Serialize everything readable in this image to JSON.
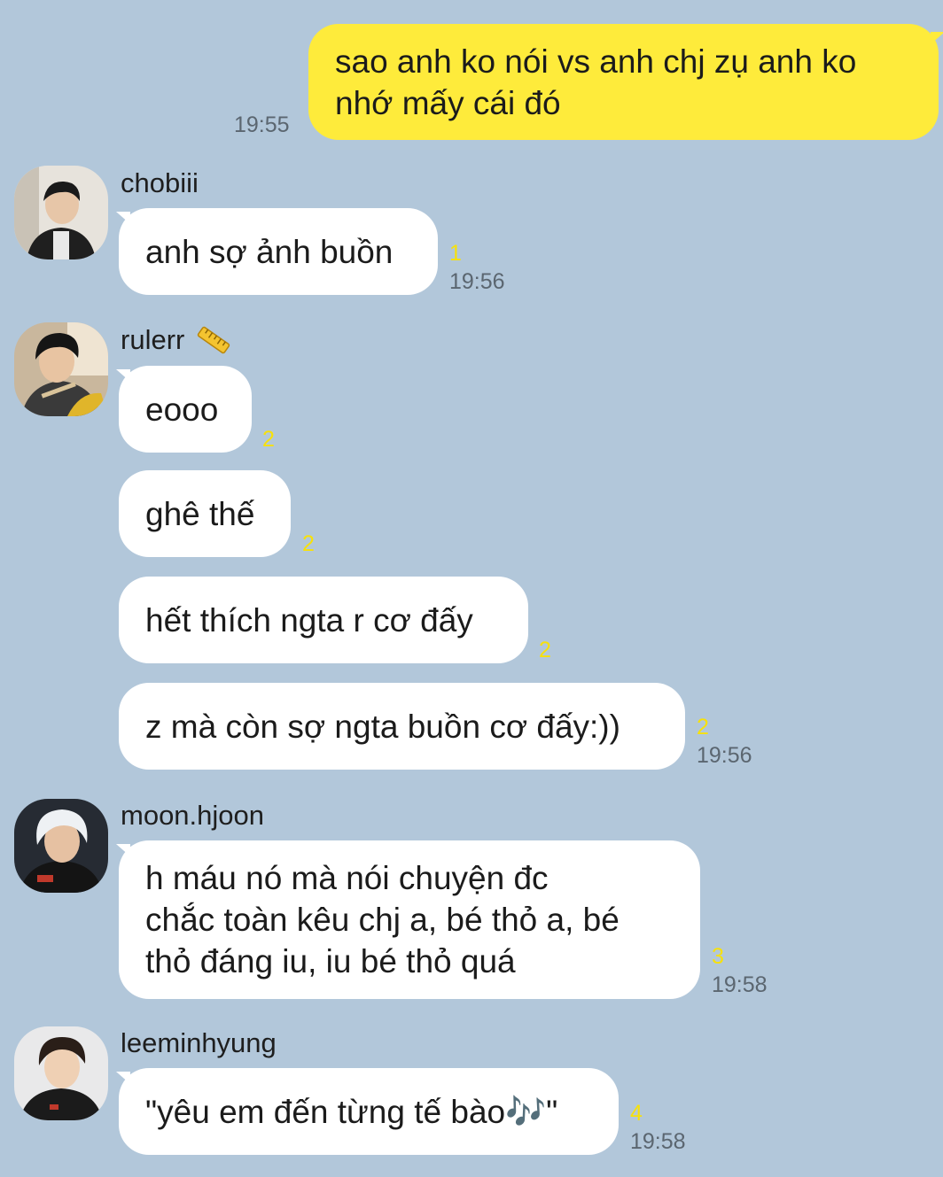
{
  "colors": {
    "background": "#b2c7da",
    "outgoing_bubble": "#feeb3b",
    "incoming_bubble": "#ffffff",
    "unread_count": "#f7e10b",
    "timestamp": "#5b6670"
  },
  "messages": {
    "m1": {
      "text": "sao anh ko nói vs anh chj zụ anh ko\nnhớ mấy cái đó",
      "time": "19:55"
    },
    "chobiii": {
      "name": "chobiii",
      "text": "anh sợ ảnh buồn",
      "unread": "1",
      "time": "19:56"
    },
    "rulerr": {
      "name": "rulerr",
      "badge_icon": "ruler-emoji-icon",
      "b1": {
        "text": "eooo",
        "unread": "2"
      },
      "b2": {
        "text": "ghê thế",
        "unread": "2"
      },
      "b3": {
        "text": "hết thích ngta r cơ đấy",
        "unread": "2"
      },
      "b4": {
        "text": "z mà còn sợ ngta buồn cơ đấy:))",
        "unread": "2",
        "time": "19:56"
      }
    },
    "moon": {
      "name": "moon.hjoon",
      "text": "h máu nó mà nói chuyện đc\nchắc toàn kêu chj a, bé thỏ a, bé\nthỏ đáng iu, iu bé thỏ quá",
      "unread": "3",
      "time": "19:58"
    },
    "leeminhyung": {
      "name": "leeminhyung",
      "text": "\"yêu em đến từng tế bào🎶\"",
      "unread": "4",
      "time": "19:58"
    }
  }
}
